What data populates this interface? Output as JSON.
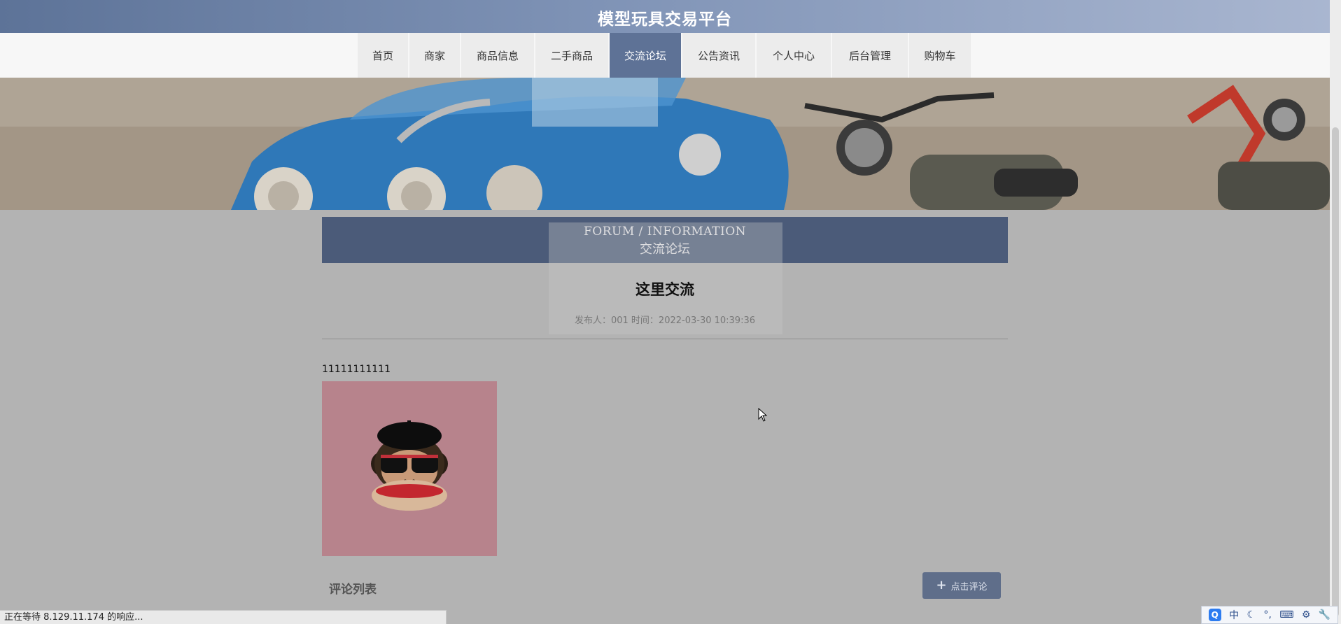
{
  "header": {
    "site_title": "模型玩具交易平台"
  },
  "nav": {
    "items": [
      {
        "label": "首页",
        "active": false,
        "width": 74
      },
      {
        "label": "商家",
        "active": false,
        "width": 74
      },
      {
        "label": "商品信息",
        "active": false,
        "width": 106
      },
      {
        "label": "二手商品",
        "active": false,
        "width": 106
      },
      {
        "label": "交流论坛",
        "active": true,
        "width": 104
      },
      {
        "label": "公告资讯",
        "active": false,
        "width": 106
      },
      {
        "label": "个人中心",
        "active": false,
        "width": 108
      },
      {
        "label": "后台管理",
        "active": false,
        "width": 110
      },
      {
        "label": "购物车",
        "active": false,
        "width": 90
      }
    ]
  },
  "section": {
    "heading_en": "FORUM / INFORMATION",
    "heading_zh": "交流论坛"
  },
  "post": {
    "title": "这里交流",
    "meta": "发布人：001 时间：2022-03-30 10:39:36",
    "body": "11111111111"
  },
  "comments": {
    "title": "评论列表",
    "button_label": "点击评论"
  },
  "status": {
    "text": "正在等待 8.129.11.174 的响应..."
  },
  "ime": {
    "items": [
      "中"
    ]
  },
  "colors": {
    "accent": "#5e7296",
    "heading_bg": "#4b5b79",
    "page_bg": "#b3b3b3",
    "image_bg": "#b7838c"
  }
}
